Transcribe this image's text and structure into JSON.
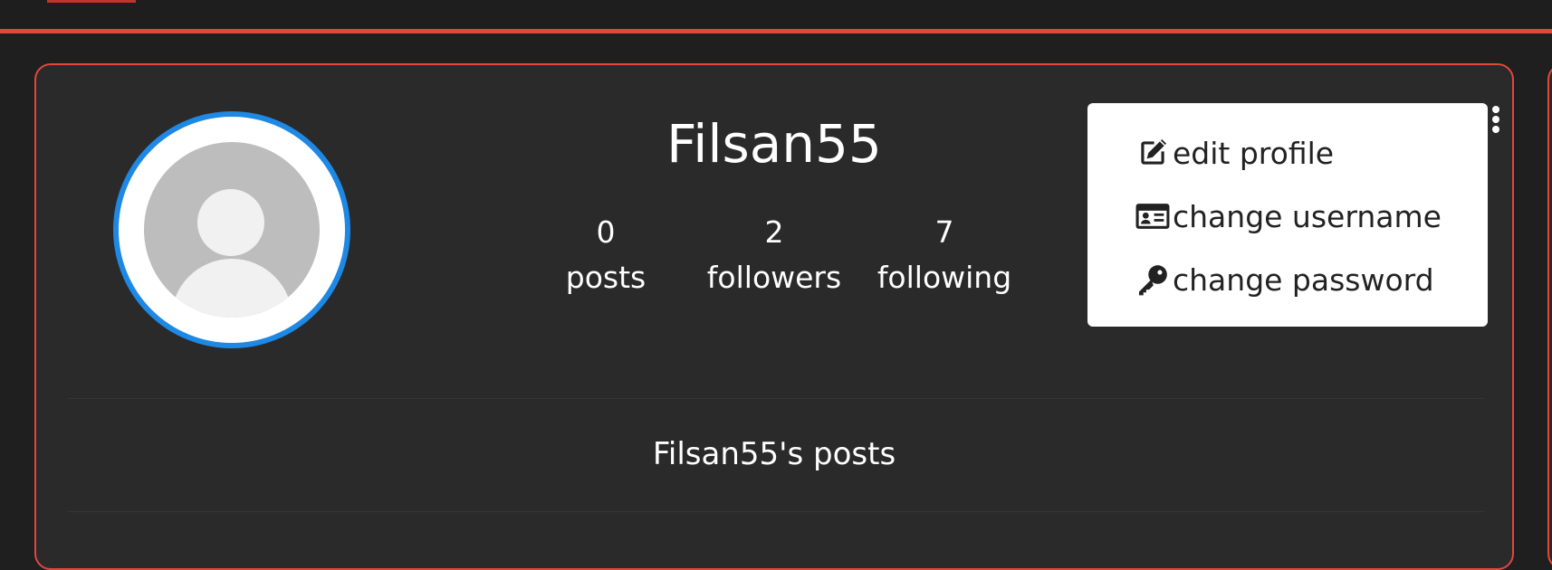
{
  "profile": {
    "username": "Filsan55",
    "stats": [
      {
        "count": "0",
        "label": "posts"
      },
      {
        "count": "2",
        "label": "followers"
      },
      {
        "count": "7",
        "label": "following"
      }
    ],
    "posts_heading": "Filsan55's posts"
  },
  "menu": {
    "items": [
      {
        "label": "edit profile",
        "icon": "edit-icon"
      },
      {
        "label": "change username",
        "icon": "id-card-icon"
      },
      {
        "label": "change password",
        "icon": "key-icon"
      }
    ]
  },
  "colors": {
    "accent": "#e0483e",
    "avatar_ring": "#1e88e5",
    "card_bg": "#2a2a2a",
    "page_bg": "#1f1f1f"
  }
}
